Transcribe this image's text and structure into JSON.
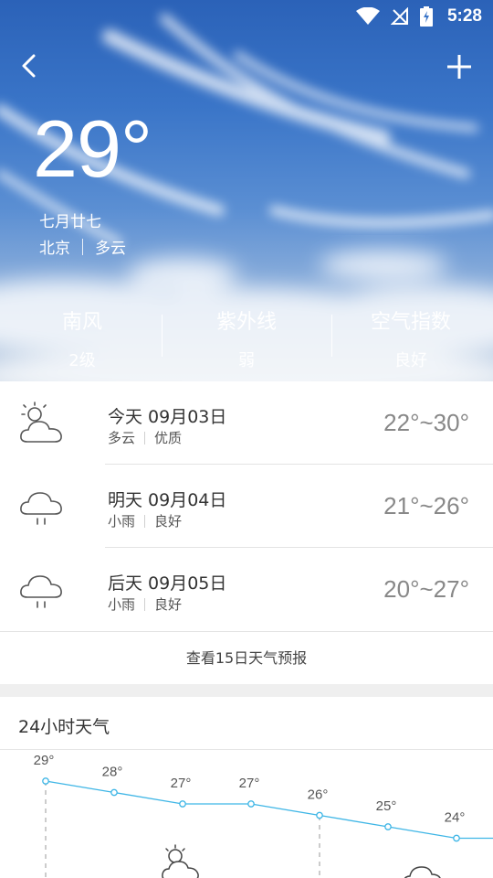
{
  "status": {
    "time": "5:28"
  },
  "hero": {
    "temperature": "29°",
    "lunar_date": "七月廿七",
    "city": "北京",
    "condition": "多云",
    "stats": [
      {
        "label": "南风",
        "value": "2级"
      },
      {
        "label": "紫外线",
        "value": "弱"
      },
      {
        "label": "空气指数",
        "value": "良好"
      }
    ]
  },
  "forecast": [
    {
      "title": "今天 09月03日",
      "condition": "多云",
      "quality": "优质",
      "temp": "22°~30°",
      "icon": "partly-cloudy-icon"
    },
    {
      "title": "明天 09月04日",
      "condition": "小雨",
      "quality": "良好",
      "temp": "21°~26°",
      "icon": "light-rain-icon"
    },
    {
      "title": "后天 09月05日",
      "condition": "小雨",
      "quality": "良好",
      "temp": "20°~27°",
      "icon": "light-rain-icon"
    }
  ],
  "more_link": "查看15日天气预报",
  "hourly": {
    "title": "24小时天气",
    "temps": [
      "29°",
      "28°",
      "27°",
      "27°",
      "26°",
      "25°",
      "24°"
    ],
    "values": [
      29,
      28,
      27,
      27,
      26,
      25,
      24
    ],
    "line_color": "#3fb6e6"
  }
}
